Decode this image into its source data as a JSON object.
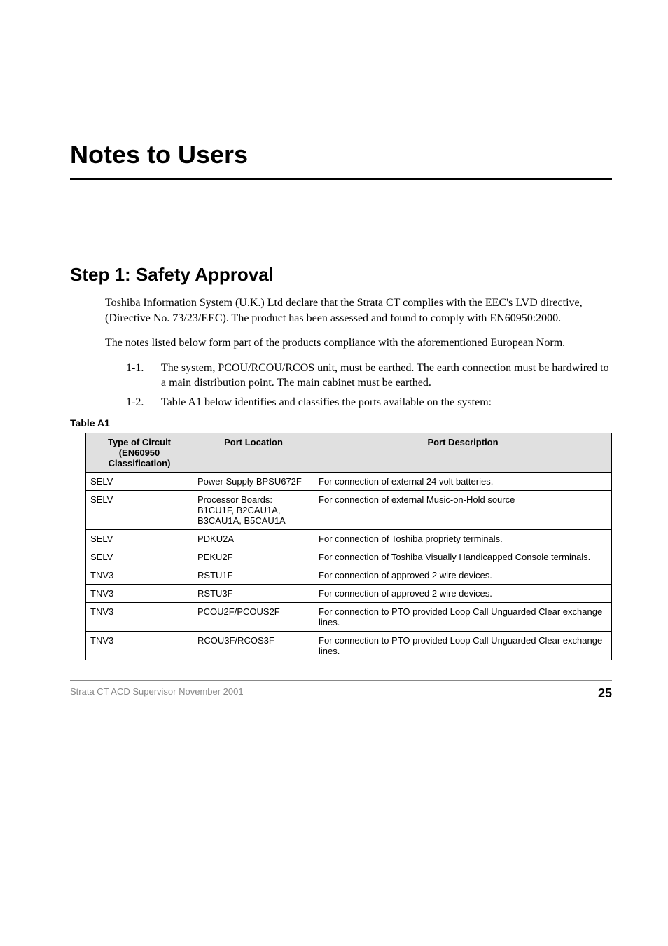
{
  "main_title": "Notes to Users",
  "section_title": "Step 1:   Safety Approval",
  "para1": "Toshiba Information System (U.K.) Ltd declare that the Strata CT complies with the EEC's LVD directive, (Directive No. 73/23/EEC). The product has been assessed and found to comply with EN60950:2000.",
  "para2": "The notes listed below form part of the products compliance with the aforementioned European Norm.",
  "list": [
    {
      "num": "1-1.",
      "text": "The system, PCOU/RCOU/RCOS unit, must be earthed. The earth connection must be hardwired to a main distribution point. The main cabinet must be earthed."
    },
    {
      "num": "1-2.",
      "text": "Table A1 below identifies and classifies the ports available on the system:"
    }
  ],
  "table_label": "Table A1",
  "table": {
    "headers": [
      "Type of Circuit (EN60950 Classification)",
      "Port Location",
      "Port Description"
    ],
    "rows": [
      [
        "SELV",
        "Power Supply BPSU672F",
        "For connection of external 24 volt batteries."
      ],
      [
        "SELV",
        "Processor Boards: B1CU1F, B2CAU1A, B3CAU1A, B5CAU1A",
        "For connection of external Music-on-Hold source"
      ],
      [
        "SELV",
        "PDKU2A",
        "For connection of Toshiba propriety terminals."
      ],
      [
        "SELV",
        "PEKU2F",
        "For connection of Toshiba Visually Handicapped Console terminals."
      ],
      [
        "TNV3",
        "RSTU1F",
        "For connection of approved 2 wire devices."
      ],
      [
        "TNV3",
        "RSTU3F",
        "For connection of approved 2 wire devices."
      ],
      [
        "TNV3",
        "PCOU2F/PCOUS2F",
        "For connection to PTO provided Loop Call Unguarded Clear exchange lines."
      ],
      [
        "TNV3",
        "RCOU3F/RCOS3F",
        "For connection to PTO provided Loop Call Unguarded Clear exchange lines."
      ]
    ]
  },
  "footer_left": "Strata CT ACD Supervisor  November 2001",
  "footer_right": "25"
}
